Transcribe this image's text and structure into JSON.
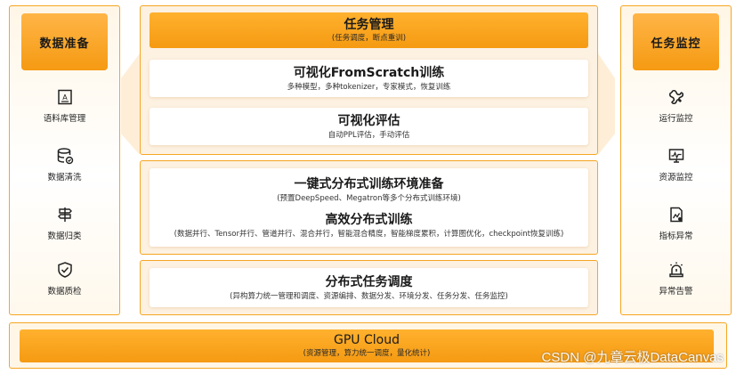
{
  "left_panel": {
    "title": "数据准备",
    "items": [
      {
        "label": "语料库管理",
        "icon": "corpus-doc-icon"
      },
      {
        "label": "数据清洗",
        "icon": "database-check-icon"
      },
      {
        "label": "数据归类",
        "icon": "signpost-icon"
      },
      {
        "label": "数据质检",
        "icon": "shield-check-icon"
      }
    ]
  },
  "right_panel": {
    "title": "任务监控",
    "items": [
      {
        "label": "运行监控",
        "icon": "run-monitor-icon"
      },
      {
        "label": "资源监控",
        "icon": "resource-monitor-icon"
      },
      {
        "label": "指标异常",
        "icon": "metric-anomaly-icon"
      },
      {
        "label": "异常告警",
        "icon": "alarm-icon"
      }
    ]
  },
  "task_management": {
    "title": "任务管理",
    "subtitle": "(任务调度，断点重训)"
  },
  "visual_training": {
    "title": "可视化FromScratch训练",
    "subtitle": "多种模型，多种tokenizer，专家模式，恢复训练"
  },
  "visual_eval": {
    "title": "可视化评估",
    "subtitle": "自动PPL评估，手动评估"
  },
  "distributed_env": {
    "title": "一键式分布式训练环境准备",
    "subtitle": "(预置DeepSpeed、Megatron等多个分布式训练环境)"
  },
  "efficient_training": {
    "title": "高效分布式训练",
    "subtitle": "(数据并行、Tensor并行、管道并行、混合并行，智能混合精度，智能梯度累积，计算图优化，checkpoint恢复训练)"
  },
  "distributed_scheduling": {
    "title": "分布式任务调度",
    "subtitle": "(异构算力统一管理和调度、资源编排、数据分发、环境分发、任务分发、任务监控)"
  },
  "gpu_cloud": {
    "title": "GPU Cloud",
    "subtitle": "(资源管理，算力统一调度，量化统计)"
  },
  "watermark": "CSDN @九章云极DataCanvas",
  "colors": {
    "accent": "#f59a12",
    "border": "#f5a623",
    "panel_bg": "#fdf1e1"
  }
}
